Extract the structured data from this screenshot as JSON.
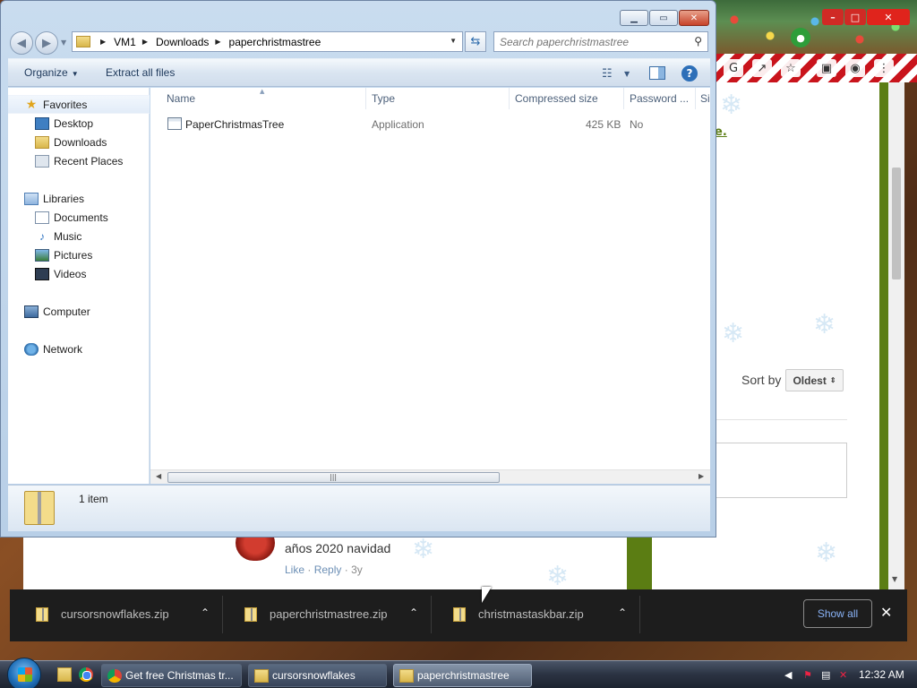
{
  "explorer": {
    "breadcrumb": [
      "VM1",
      "Downloads",
      "paperchristmastree"
    ],
    "search_placeholder": "Search paperchristmastree",
    "commands": {
      "organize": "Organize",
      "extract": "Extract all files"
    },
    "nav": {
      "favorites": {
        "label": "Favorites",
        "items": [
          "Desktop",
          "Downloads",
          "Recent Places"
        ]
      },
      "libraries": {
        "label": "Libraries",
        "items": [
          "Documents",
          "Music",
          "Pictures",
          "Videos"
        ]
      },
      "computer": "Computer",
      "network": "Network"
    },
    "columns": [
      "Name",
      "Type",
      "Compressed size",
      "Password ...",
      "Si"
    ],
    "files": [
      {
        "name": "PaperChristmasTree",
        "type": "Application",
        "size": "425 KB",
        "password": "No"
      }
    ],
    "item_count": "1 item"
  },
  "browser": {
    "link_fragment": "e.",
    "sort_label": "Sort by",
    "sort_value": "Oldest",
    "comment": {
      "text": "años 2020 navidad",
      "like": "Like",
      "reply": "Reply",
      "age": "3y",
      "dot": "·"
    }
  },
  "downloads": {
    "items": [
      "cursorsnowflakes.zip",
      "paperchristmastree.zip",
      "christmastaskbar.zip"
    ],
    "show_all": "Show all"
  },
  "taskbar": {
    "tasks": [
      "Get free Christmas tr...",
      "cursorsnowflakes",
      "paperchristmastree"
    ],
    "clock": "12:32 AM"
  },
  "icons": {
    "favorites": "star-icon",
    "desktop": "desktop-icon",
    "downloads": "downloads-folder-icon",
    "recent": "recent-places-icon",
    "libraries": "libraries-icon",
    "documents": "documents-icon",
    "music": "music-icon",
    "pictures": "pictures-icon",
    "videos": "videos-icon",
    "computer": "computer-icon",
    "network": "network-icon"
  }
}
